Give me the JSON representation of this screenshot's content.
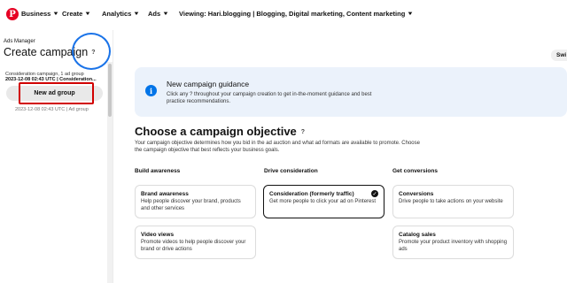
{
  "topbar": {
    "logo": "P",
    "items": [
      {
        "label": "Business",
        "chevron": "chevron-down-icon"
      },
      {
        "label": "Create",
        "chevron": "chevron-down-icon"
      },
      {
        "label": "Analytics",
        "chevron": "chevron-down-icon"
      },
      {
        "label": "Ads",
        "chevron": "chevron-down-icon"
      }
    ],
    "viewing": "Viewing: Hari.blogging | Blogging, Digital marketing, Content marketing"
  },
  "sidebar": {
    "breadcrumb": "Ads Manager",
    "title": "Create campaign",
    "help": "?",
    "summary": "Consideration campaign, 1 ad group",
    "campaign_name": "2023-12-08 02:43 UTC | Consideration...",
    "new_ad_group_label": "New ad group",
    "ad_group_name": "2023-12-08 02:43 UTC | Ad group"
  },
  "switch_button": "Swi",
  "guidance": {
    "icon": "info-icon",
    "title": "New campaign guidance",
    "text": "Click any ? throughout your campaign creation to get in-the-moment guidance and best practice recommendations."
  },
  "objective": {
    "title": "Choose a campaign objective",
    "help": "?",
    "description": "Your campaign objective determines how you bid in the ad auction and what ad formats are available to promote. Choose the campaign objective that best reflects your business goals.",
    "columns": [
      "Build awareness",
      "Drive consideration",
      "Get conversions"
    ],
    "cards": [
      {
        "title": "Brand awareness",
        "desc": "Help people discover your brand, products and other services"
      },
      {
        "title": "Consideration (formerly traffic)",
        "desc": "Get more people to click your ad on Pinterest",
        "selected": true
      },
      {
        "title": "Conversions",
        "desc": "Drive people to take actions on your website"
      },
      {
        "title": "Video views",
        "desc": "Promote videos to help people discover your brand or drive actions"
      },
      {
        "title": "Catalog sales",
        "desc": "Promote your product inventory with shopping ads"
      }
    ]
  },
  "colors": {
    "brand": "#e60023",
    "accent": "#0074e8",
    "guidance_bg": "#ebf2fb",
    "highlight_red": "#d10000",
    "highlight_blue": "#1a73e8"
  }
}
